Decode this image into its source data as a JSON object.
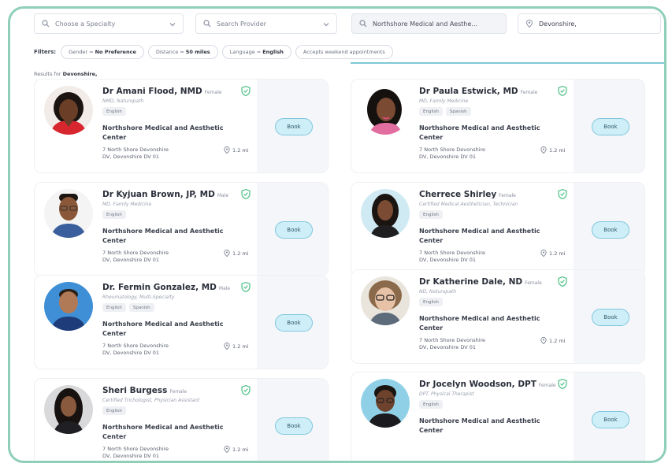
{
  "search": {
    "specialty_placeholder": "Choose a Specialty",
    "provider_placeholder": "Search Provider",
    "location_value": "Northshore Medical and Aesthe...",
    "city_value": "Devonshire,"
  },
  "filters": {
    "label": "Filters:",
    "gender_prefix": "Gender = ",
    "gender_value": "No Preference",
    "distance_prefix": "Distance = ",
    "distance_value": "50 miles",
    "language_prefix": "Language =",
    "language_value": "English",
    "weekend": "Accepts weekend appointments"
  },
  "results": {
    "prefix": "Results for",
    "location": "Devonshire,"
  },
  "book_label": "Book",
  "providers": [
    {
      "name": "Dr Amani Flood, NMD",
      "gender": "Female",
      "title": "NMD, Naturopath",
      "languages": [
        "English"
      ],
      "clinic": "Northshore Medical and Aesthetic Center",
      "address_line1": "7 North Shore Devonshire",
      "address_line2": "DV, Devonshire DV 01",
      "distance": "1.2 mi",
      "avatar_icon": "provider-photo-icon"
    },
    {
      "name": "Dr Paula Estwick, MD",
      "gender": "Female",
      "title": "MD, Family Medicine",
      "languages": [
        "English",
        "Spanish"
      ],
      "clinic": "Northshore Medical and Aesthetic Center",
      "address_line1": "7 North Shore Devonshire",
      "address_line2": "DV, Devonshire DV 01",
      "distance": "1.2 mi",
      "avatar_icon": "provider-photo-icon"
    },
    {
      "name": "Dr Kyjuan Brown, JP, MD",
      "gender": "Male",
      "title": "MD, Family Medicine",
      "languages": [
        "English"
      ],
      "clinic": "Northshore Medical and Aesthetic Center",
      "address_line1": "7 North Shore Devonshire",
      "address_line2": "DV, Devonshire DV 01",
      "distance": "1.2 mi",
      "avatar_icon": "provider-photo-icon"
    },
    {
      "name": "Cherrece Shirley",
      "gender": "Female",
      "title": "Certified Medical Aesthetician, Technician",
      "languages": [
        "English"
      ],
      "clinic": "Northshore Medical and Aesthetic Center",
      "address_line1": "7 North Shore Devonshire",
      "address_line2": "DV, Devonshire DV 01",
      "distance": "1.2 mi",
      "avatar_icon": "provider-photo-icon"
    },
    {
      "name": "Dr. Fermin Gonzalez, MD",
      "gender": "Male",
      "title": "Rheumatology, Multi-Specialty",
      "languages": [
        "English",
        "Spanish"
      ],
      "clinic": "Northshore Medical and Aesthetic Center",
      "address_line1": "7 North Shore Devonshire",
      "address_line2": "DV, Devonshire DV 01",
      "distance": "1.2 mi",
      "avatar_icon": "provider-photo-icon"
    },
    {
      "name": "Dr Katherine Dale, ND",
      "gender": "Female",
      "title": "ND, Naturopath",
      "languages": [
        "English"
      ],
      "clinic": "Northshore Medical and Aesthetic Center",
      "address_line1": "7 North Shore Devonshire",
      "address_line2": "DV, Devonshire DV 01",
      "distance": "1.2 mi",
      "avatar_icon": "provider-photo-icon"
    },
    {
      "name": "Sheri Burgess",
      "gender": "Female",
      "title": "Certified Trichologist, Physician Assistant",
      "languages": [
        "English"
      ],
      "clinic": "Northshore Medical and Aesthetic Center",
      "address_line1": "7 North Shore Devonshire",
      "address_line2": "DV, Devonshire DV 01",
      "distance": "1.2 mi",
      "avatar_icon": "provider-photo-icon"
    },
    {
      "name": "Dr Jocelyn Woodson, DPT",
      "gender": "Female",
      "title": "DPT, Physical Therapist",
      "languages": [
        "English"
      ],
      "clinic": "Northshore Medical and Aesthetic Center",
      "address_line1": "",
      "address_line2": "",
      "distance": "",
      "avatar_icon": "provider-photo-icon"
    }
  ],
  "colors": {
    "frame_border": "#8fcfb8",
    "book_fill": "#cfeff8",
    "book_border": "#7fc6dc",
    "verified_green": "#4cbf84"
  }
}
